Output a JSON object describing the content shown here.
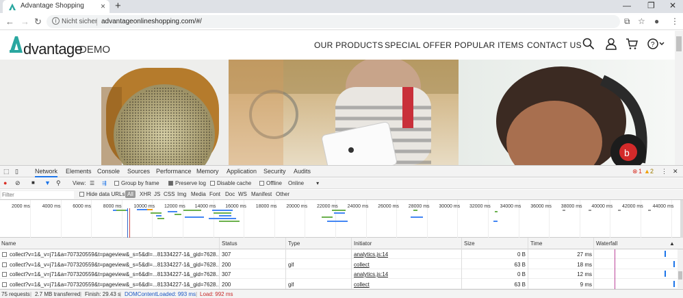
{
  "browser": {
    "tab_title": "Advantage Shopping",
    "omnibox_security": "Nicht sicher",
    "omnibox_url": "advantageonlineshopping.com/#/"
  },
  "site": {
    "brand_name": "dvantage",
    "brand_suffix": "DEMO",
    "menu": [
      "OUR PRODUCTS",
      "SPECIAL OFFER",
      "POPULAR ITEMS",
      "CONTACT US"
    ],
    "accent": "#2aa7a0"
  },
  "devtools": {
    "tabs": [
      "Network",
      "Elements",
      "Console",
      "Sources",
      "Performance",
      "Memory",
      "Application",
      "Security",
      "Audits"
    ],
    "active_tab": "Network",
    "errors": "1",
    "warnings": "2",
    "toolbar": {
      "view_label": "View:",
      "group_by_frame": "Group by frame",
      "preserve_log": "Preserve log",
      "disable_cache": "Disable cache",
      "offline": "Offline",
      "online": "Online"
    },
    "filter": {
      "placeholder": "Filter",
      "hide_data_urls": "Hide data URLs",
      "types": [
        "All",
        "XHR",
        "JS",
        "CSS",
        "Img",
        "Media",
        "Font",
        "Doc",
        "WS",
        "Manifest",
        "Other"
      ]
    },
    "timeline_ticks": [
      "2000 ms",
      "4000 ms",
      "6000 ms",
      "8000 ms",
      "10000 ms",
      "12000 ms",
      "14000 ms",
      "16000 ms",
      "18000 ms",
      "20000 ms",
      "22000 ms",
      "24000 ms",
      "26000 ms",
      "28000 ms",
      "30000 ms",
      "32000 ms",
      "34000 ms",
      "36000 ms",
      "38000 ms",
      "40000 ms",
      "42000 ms",
      "44000 ms"
    ],
    "columns": [
      "Name",
      "Status",
      "Type",
      "Initiator",
      "Size",
      "Time",
      "Waterfall"
    ],
    "rows": [
      {
        "name": "collect?v=1&_v=j71&a=707320559&t=pageview&_s=5&dl=...81334227-1&_gid=7628...",
        "status": "307",
        "type": "",
        "initiator": "analytics.js:14",
        "size": "0 B",
        "time": "27 ms"
      },
      {
        "name": "collect?v=1&_v=j71&a=707320559&t=pageview&_s=5&dl=...81334227-1&_gid=7628...",
        "status": "200",
        "type": "gif",
        "initiator": "collect",
        "size": "63 B",
        "time": "18 ms"
      },
      {
        "name": "collect?v=1&_v=j71&a=707320559&t=pageview&_s=6&dl=...81334227-1&_gid=7628...",
        "status": "307",
        "type": "",
        "initiator": "analytics.js:14",
        "size": "0 B",
        "time": "12 ms"
      },
      {
        "name": "collect?v=1&_v=j71&a=707320559&t=pageview&_s=6&dl=...81334227-1&_gid=7628...",
        "status": "200",
        "type": "gif",
        "initiator": "collect",
        "size": "63 B",
        "time": "9 ms"
      }
    ],
    "status": {
      "requests": "75 requests",
      "transferred": "2.7 MB transferred",
      "finish": "Finish: 29.43 s",
      "dom_loaded": "DOMContentLoaded: 993 ms",
      "load": "Load: 992 ms"
    }
  }
}
